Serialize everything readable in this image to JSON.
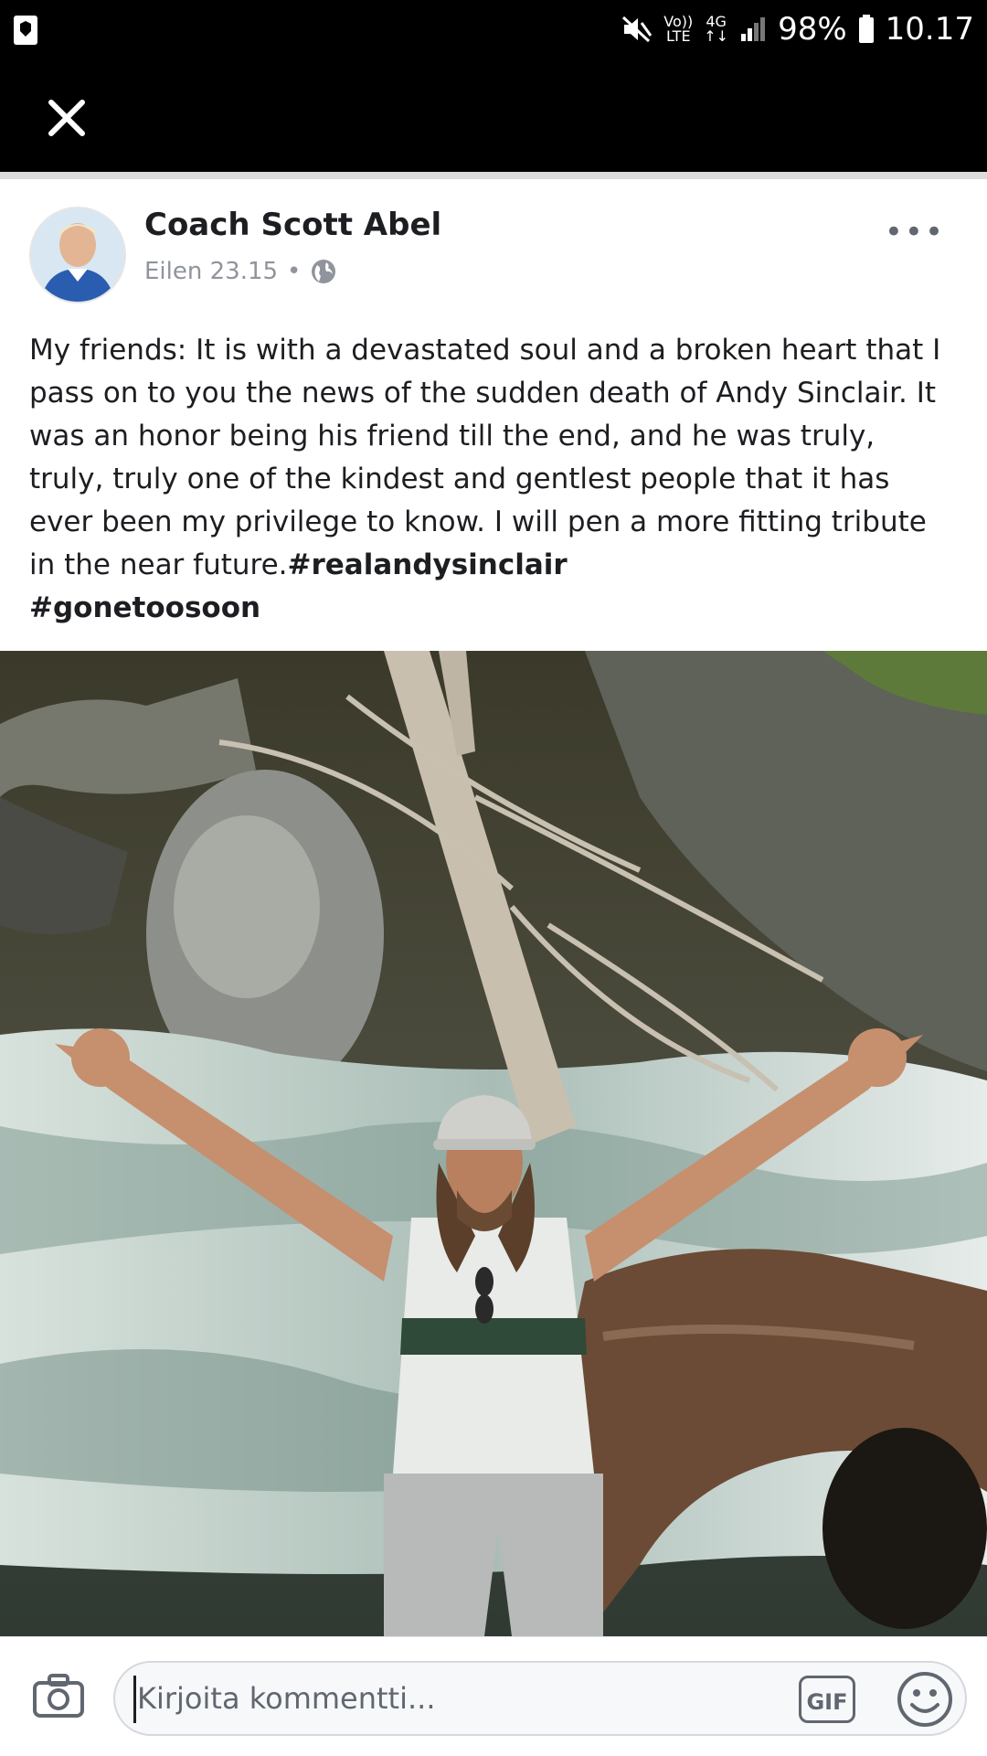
{
  "status_bar": {
    "network_top": "Vo))",
    "network_bottom": "LTE",
    "signal_type": "4G",
    "battery": "98%",
    "time": "10.17"
  },
  "post": {
    "author": "Coach Scott Abel",
    "timestamp": "Eilen 23.15",
    "separator": "•",
    "text_body": "My friends: It is with a devastated soul and a broken heart that I pass on to you the news of the sudden death of Andy Sinclair. It was an honor being his friend till the end, and he was truly, truly, truly one of the kindest and gentlest people that it has ever been my privilege to know.  I will pen a more fitting tribute in the near future.",
    "hashtag_1": "#realandysinclair",
    "hashtag_2": "#gonetoosoon",
    "more_label": "•••"
  },
  "comment": {
    "placeholder": "Kirjoita kommentti...",
    "gif_label": "GIF"
  }
}
